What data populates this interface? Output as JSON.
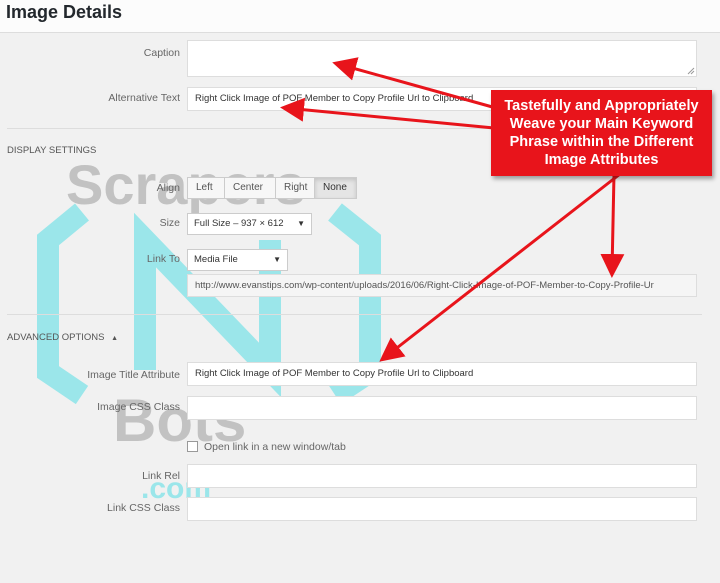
{
  "header": {
    "title": "Image Details"
  },
  "caption": {
    "label": "Caption",
    "value": ""
  },
  "alt_text": {
    "label": "Alternative Text",
    "value": "Right Click Image of POF Member to Copy Profile Url to Clipboard"
  },
  "display_settings": {
    "title": "DISPLAY SETTINGS",
    "align": {
      "label": "Align",
      "options": [
        "Left",
        "Center",
        "Right",
        "None"
      ],
      "selected": "None"
    },
    "size": {
      "label": "Size",
      "value": "Full Size – 937 × 612"
    },
    "link_to": {
      "label": "Link To",
      "value": "Media File",
      "url": "http://www.evanstips.com/wp-content/uploads/2016/06/Right-Click-Image-of-POF-Member-to-Copy-Profile-Ur"
    }
  },
  "advanced": {
    "title": "ADVANCED OPTIONS",
    "image_title": {
      "label": "Image Title Attribute",
      "value": "Right Click Image of POF Member to Copy Profile Url to Clipboard"
    },
    "css_class": {
      "label": "Image CSS Class",
      "value": ""
    },
    "new_window": {
      "label": "Open link in a new window/tab",
      "checked": false
    },
    "link_rel": {
      "label": "Link Rel",
      "value": ""
    },
    "link_css": {
      "label": "Link CSS Class",
      "value": ""
    }
  },
  "callout": {
    "text": "Tastefully and Appropriately Weave your Main Keyword Phrase within the Different Image Attributes"
  },
  "watermark": {
    "line1": "Scrapers",
    "line2": "Bots",
    "line3": ".com"
  },
  "colors": {
    "callout": "#e8141b",
    "arrow": "#e8141b",
    "watermark_icon": "#7fe3e8"
  }
}
